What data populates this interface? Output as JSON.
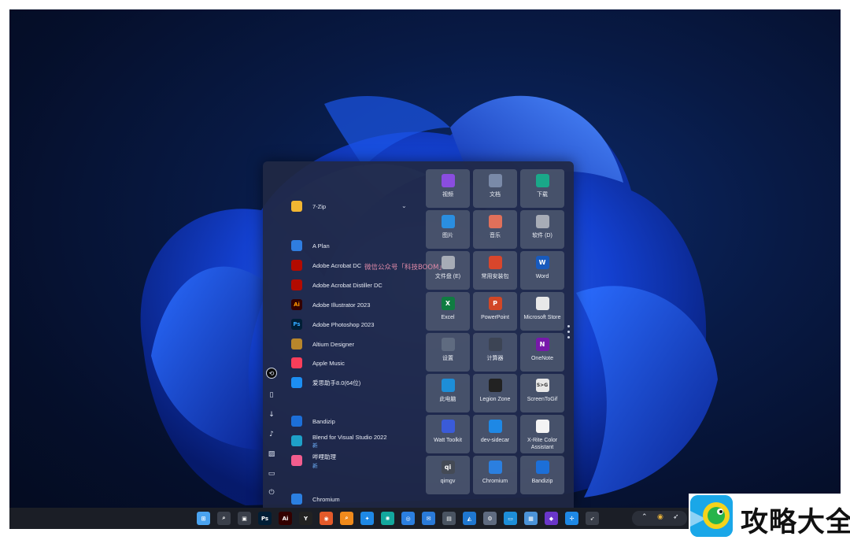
{
  "start_menu": {
    "apps": [
      {
        "label": "7-Zip",
        "icon": "folder-icon",
        "color": "#f2b632",
        "expandable": true
      },
      {
        "label": "A Plan",
        "icon": "a-plan-icon",
        "color": "#2f7de0"
      },
      {
        "label": "Adobe Acrobat DC",
        "icon": "acrobat-icon",
        "color": "#b30b00"
      },
      {
        "label": "Adobe Acrobat Distiller DC",
        "icon": "acrobat-distiller-icon",
        "color": "#b30b00"
      },
      {
        "label": "Adobe Illustrator 2023",
        "icon": "illustrator-icon",
        "color": "#330000",
        "glyph": "Ai",
        "glyph_color": "#ff9a00"
      },
      {
        "label": "Adobe Photoshop 2023",
        "icon": "photoshop-icon",
        "color": "#001e36",
        "glyph": "Ps",
        "glyph_color": "#31a8ff"
      },
      {
        "label": "Altium Designer",
        "icon": "altium-icon",
        "color": "#b8862b"
      },
      {
        "label": "Apple Music",
        "icon": "apple-music-icon",
        "color": "#fa3e5a"
      },
      {
        "label": "爱思助手8.0(64位)",
        "icon": "aisi-icon",
        "color": "#1c8ef2"
      },
      {
        "label": "Bandizip",
        "icon": "bandizip-icon",
        "color": "#1c6fd8"
      },
      {
        "label": "Blend for Visual Studio 2022",
        "icon": "blend-icon",
        "color": "#1ea0c8",
        "badge": "新"
      },
      {
        "label": "哔哩助理",
        "icon": "bilibili-icon",
        "color": "#f25d8e",
        "badge": "新"
      },
      {
        "label": "Chromium",
        "icon": "chromium-icon",
        "color": "#2b7fe0"
      }
    ],
    "tiles": [
      {
        "label": "视频",
        "icon": "videos-folder-icon",
        "color": "#8a4de0"
      },
      {
        "label": "文档",
        "icon": "documents-folder-icon",
        "color": "#7a8aa8"
      },
      {
        "label": "下载",
        "icon": "downloads-folder-icon",
        "color": "#1aa889"
      },
      {
        "label": "图片",
        "icon": "pictures-folder-icon",
        "color": "#2a8ee0"
      },
      {
        "label": "音乐",
        "icon": "music-folder-icon",
        "color": "#e0705a"
      },
      {
        "label": "软件 (D)",
        "icon": "drive-icon",
        "color": "#a7acb6"
      },
      {
        "label": "文件盘 (E)",
        "icon": "drive-icon",
        "color": "#a7acb6"
      },
      {
        "label": "常用安装包",
        "icon": "installer-package-icon",
        "color": "#d8462c"
      },
      {
        "label": "Word",
        "icon": "word-icon",
        "color": "#185abd",
        "glyph": "W"
      },
      {
        "label": "Excel",
        "icon": "excel-icon",
        "color": "#107c41",
        "glyph": "X"
      },
      {
        "label": "PowerPoint",
        "icon": "powerpoint-icon",
        "color": "#d24726",
        "glyph": "P"
      },
      {
        "label": "Microsoft Store",
        "icon": "store-icon",
        "color": "#e8e8e8"
      },
      {
        "label": "设置",
        "icon": "settings-gear-icon",
        "color": "#5f6b80"
      },
      {
        "label": "计算器",
        "icon": "calculator-icon",
        "color": "#3c4454"
      },
      {
        "label": "OneNote",
        "icon": "onenote-icon",
        "color": "#7719aa",
        "glyph": "N"
      },
      {
        "label": "此电脑",
        "icon": "this-pc-icon",
        "color": "#1d8ed8"
      },
      {
        "label": "Legion Zone",
        "icon": "legion-zone-icon",
        "color": "#222222"
      },
      {
        "label": "ScreenToGif",
        "icon": "screentogif-icon",
        "color": "#e8e8e8",
        "glyph": "S>G",
        "glyph_color": "#333333"
      },
      {
        "label": "Watt Toolkit",
        "icon": "watt-toolkit-icon",
        "color": "#3a5bd9"
      },
      {
        "label": "dev-sidecar",
        "icon": "dev-sidecar-icon",
        "color": "#1e88e5"
      },
      {
        "label": "X-Rite Color Assistant",
        "icon": "x-rite-icon",
        "color": "#f4f4f4"
      },
      {
        "label": "qimgv",
        "icon": "qimgv-icon",
        "color": "#444a55",
        "glyph": "qi"
      },
      {
        "label": "Chromium",
        "icon": "chromium-icon",
        "color": "#2b7fe0"
      },
      {
        "label": "Bandizip",
        "icon": "bandizip-icon",
        "color": "#1c6fd8"
      }
    ],
    "rail": [
      "user-avatar-icon",
      "document-icon",
      "download-icon",
      "music-note-icon",
      "image-icon",
      "video-icon",
      "power-icon"
    ]
  },
  "watermark": "微信公众号「科技BOOM」",
  "taskbar": {
    "items": [
      {
        "name": "start-button",
        "color": "#4aa3f0",
        "glyph": "⊞"
      },
      {
        "name": "search-icon",
        "color": "#3a3f4a",
        "glyph": "⌕"
      },
      {
        "name": "task-view-icon",
        "color": "#3a3f4a",
        "glyph": "▣"
      },
      {
        "name": "photoshop-icon",
        "color": "#001e36",
        "glyph": "Ps"
      },
      {
        "name": "illustrator-icon",
        "color": "#330000",
        "glyph": "Ai"
      },
      {
        "name": "legion-icon",
        "color": "#222222",
        "glyph": "Y"
      },
      {
        "name": "chromium-icon",
        "color": "#e45a2a",
        "glyph": "◉"
      },
      {
        "name": "everything-search-icon",
        "color": "#f08a1c",
        "glyph": "⌕"
      },
      {
        "name": "app-icon",
        "color": "#1e88e5",
        "glyph": "✦"
      },
      {
        "name": "sidecar-icon",
        "color": "#13a89e",
        "glyph": "✺"
      },
      {
        "name": "edge-icon",
        "color": "#2b7fe0",
        "glyph": "◎"
      },
      {
        "name": "mail-icon",
        "color": "#2a7ad8",
        "glyph": "✉"
      },
      {
        "name": "notepad-icon",
        "color": "#4a5462",
        "glyph": "▤"
      },
      {
        "name": "photos-icon",
        "color": "#1f77d0",
        "glyph": "◭"
      },
      {
        "name": "settings-gear-icon",
        "color": "#5f6b80",
        "glyph": "⚙"
      },
      {
        "name": "this-pc-icon",
        "color": "#1d8ed8",
        "glyph": "▭"
      },
      {
        "name": "files-icon",
        "color": "#4b93d8",
        "glyph": "▦"
      },
      {
        "name": "visual-studio-icon",
        "color": "#6a36c9",
        "glyph": "◆"
      },
      {
        "name": "dev-sidecar-icon",
        "color": "#1e88e5",
        "glyph": "✢"
      },
      {
        "name": "feather-icon",
        "color": "#3a3f4a",
        "glyph": "➶"
      }
    ],
    "tray": [
      "chevron-up-icon",
      "chrome-icon",
      "feather-icon"
    ]
  },
  "logo": {
    "text": "攻略大全"
  }
}
